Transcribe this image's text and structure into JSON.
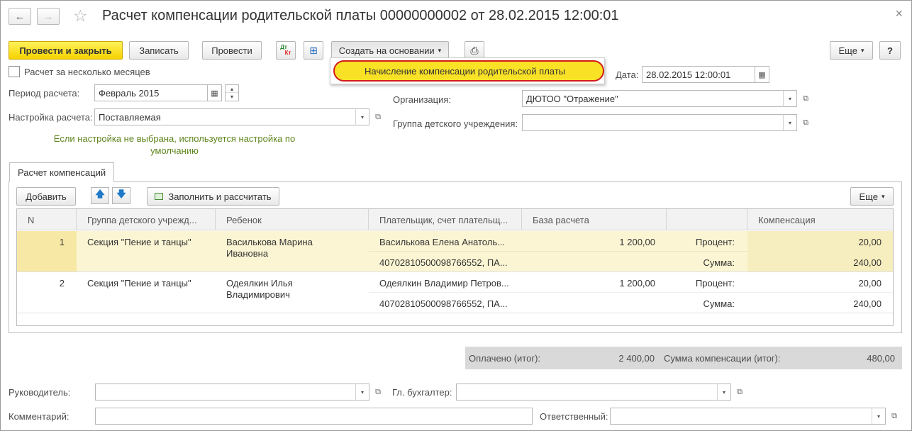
{
  "window": {
    "title": "Расчет компенсации родительской платы 00000000002 от 28.02.2015 12:00:01",
    "back_icon": "←",
    "forward_icon": "→",
    "star_icon": "☆",
    "close_icon": "×"
  },
  "toolbar": {
    "post_close": "Провести и закрыть",
    "save": "Записать",
    "post": "Провести",
    "dtkt_top": "Дт",
    "dtkt_bottom": "Кт",
    "structure_icon": "⊞",
    "create_based": "Создать на основании",
    "print_icon": "⎙",
    "more": "Еще",
    "help": "?"
  },
  "dropdown": {
    "items": [
      "Начисление компенсации родительской платы"
    ]
  },
  "form": {
    "multi_month_label": "Расчет за несколько месяцев",
    "period_label": "Период расчета:",
    "period_value": "Февраль 2015",
    "setting_label": "Настройка расчета:",
    "setting_value": "Поставляемая",
    "hint": "Если настройка не выбрана, используется настройка по умолчанию",
    "date_label": "Дата:",
    "date_value": "28.02.2015 12:00:01",
    "org_label": "Организация:",
    "org_value": "ДЮТОО \"Отражение\"",
    "group_label": "Группа детского учреждения:",
    "group_value": ""
  },
  "tabs": [
    "Расчет компенсаций"
  ],
  "table_toolbar": {
    "add": "Добавить",
    "up_icon": "🡅",
    "down_icon": "🡇",
    "fill": "Заполнить и рассчитать",
    "more": "Еще"
  },
  "table": {
    "headers": [
      "N",
      "Группа детского учрежд...",
      "Ребенок",
      "Плательщик, счет плательщ...",
      "База расчета",
      "",
      "Компенсация"
    ],
    "rows": [
      {
        "n": "1",
        "group": "Секция \"Пение и танцы\"",
        "child_line1": "Василькова Марина",
        "child_line2": "Ивановна",
        "payer": "Василькова Елена Анатоль...",
        "account": "40702810500098766552, ПА...",
        "base": "1 200,00",
        "percent_label": "Процент:",
        "sum_label": "Сумма:",
        "percent": "20,00",
        "sum": "240,00"
      },
      {
        "n": "2",
        "group": "Секция \"Пение и танцы\"",
        "child_line1": "Одеялкин Илья",
        "child_line2": "Владимирович",
        "payer": "Одеялкин Владимир Петров...",
        "account": "40702810500098766552, ПА...",
        "base": "1 200,00",
        "percent_label": "Процент:",
        "sum_label": "Сумма:",
        "percent": "20,00",
        "sum": "240,00"
      }
    ]
  },
  "totals": {
    "paid_label": "Оплачено (итог):",
    "paid_value": "2 400,00",
    "comp_label": "Сумма компенсации (итог):",
    "comp_value": "480,00"
  },
  "footer": {
    "head_label": "Руководитель:",
    "head_value": "",
    "accountant_label": "Гл. бухгалтер:",
    "accountant_value": "",
    "comment_label": "Комментарий:",
    "comment_value": "",
    "responsible_label": "Ответственный:",
    "responsible_value": ""
  },
  "glyphs": {
    "dropdown": "▾",
    "open": "⧉",
    "calendar": "▦",
    "spin_up": "▴",
    "spin_down": "▾"
  },
  "colors": {
    "primary_button": "#f6d200",
    "hint_text": "#60851e",
    "popup_highlight": "#f9e126",
    "popup_outline": "#d21b1b",
    "selected_row": "#fbf5d3"
  }
}
